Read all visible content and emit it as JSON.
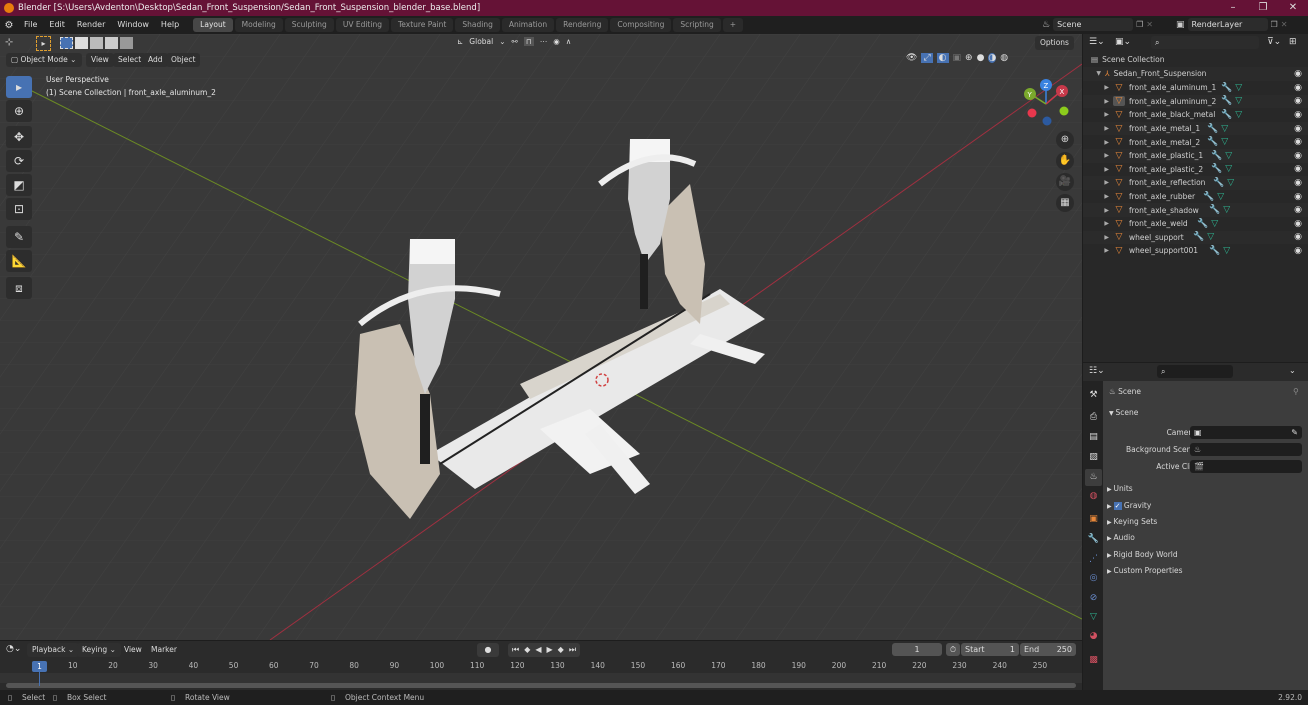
{
  "window": {
    "title": "Blender [S:\\Users\\Avdenton\\Desktop\\Sedan_Front_Suspension/Sedan_Front_Suspension_blender_base.blend]",
    "minimize": "–",
    "maximize": "❐",
    "close": "✕"
  },
  "menu": [
    "File",
    "Edit",
    "Render",
    "Window",
    "Help"
  ],
  "workspaces": [
    "Layout",
    "Modeling",
    "Sculpting",
    "UV Editing",
    "Texture Paint",
    "Shading",
    "Animation",
    "Rendering",
    "Compositing",
    "Scripting"
  ],
  "active_workspace": "Layout",
  "scene_selector": {
    "value": "Scene"
  },
  "layer_selector": {
    "value": "RenderLayer"
  },
  "viewport": {
    "mode": "Object Mode",
    "menus": [
      "View",
      "Select",
      "Add",
      "Object"
    ],
    "transform_orientation": "Global",
    "options_label": "Options",
    "overlay_line1": "User Perspective",
    "overlay_line2": "(1) Scene Collection | front_axle_aluminum_2",
    "gizmo": {
      "x": "X",
      "y": "Y",
      "z": "Z"
    }
  },
  "colors": {
    "x_axis": "#c8394a",
    "y_axis": "#7aa82c",
    "z_axis": "#3a82e0",
    "accent": "#4772b3",
    "title_bar": "#651236"
  },
  "outliner": {
    "root": "Scene Collection",
    "collection": "Sedan_Front_Suspension",
    "items": [
      "front_axle_aluminum_1",
      "front_axle_aluminum_2",
      "front_axle_black_metal",
      "front_axle_metal_1",
      "front_axle_metal_2",
      "front_axle_plastic_1",
      "front_axle_plastic_2",
      "front_axle_reflection",
      "front_axle_rubber",
      "front_axle_shadow",
      "front_axle_weld",
      "wheel_support",
      "wheel_support001"
    ],
    "selected": "front_axle_aluminum_2"
  },
  "properties": {
    "header": "Scene",
    "panel": "Scene",
    "fields": [
      {
        "label": "Camera",
        "value": ""
      },
      {
        "label": "Background Scene",
        "value": ""
      },
      {
        "label": "Active Clip",
        "value": ""
      }
    ],
    "subpanels": [
      "Units",
      "Gravity",
      "Keying Sets",
      "Audio",
      "Rigid Body World",
      "Custom Properties"
    ],
    "gravity_checked": true
  },
  "timeline": {
    "menus": [
      "Playback",
      "Keying",
      "View",
      "Marker"
    ],
    "current_frame": "1",
    "start_label": "Start",
    "start": "1",
    "end_label": "End",
    "end": "250",
    "ticks": [
      "10",
      "20",
      "30",
      "40",
      "50",
      "60",
      "70",
      "80",
      "90",
      "100",
      "110",
      "120",
      "130",
      "140",
      "150",
      "160",
      "170",
      "180",
      "190",
      "200",
      "210",
      "220",
      "230",
      "240",
      "250"
    ],
    "playhead": "1"
  },
  "statusbar": {
    "select": "Select",
    "box_select": "Box Select",
    "rotate": "Rotate View",
    "context": "Object Context Menu",
    "version": "2.92.0"
  }
}
